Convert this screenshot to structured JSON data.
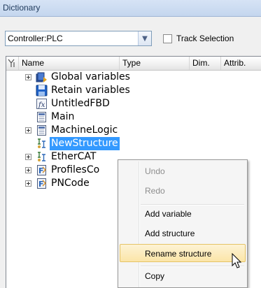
{
  "window": {
    "title": "Dictionary"
  },
  "toolbar": {
    "controller_select": "Controller:PLC",
    "track_selection_label": "Track Selection",
    "track_selection_checked": false
  },
  "tree": {
    "columns": [
      {
        "label": "Name"
      },
      {
        "label": "Type"
      },
      {
        "label": "Dim."
      },
      {
        "label": "Attrib."
      }
    ],
    "rows": [
      {
        "label": "Global variables",
        "icon": "global-variables-icon",
        "expandable": true,
        "selected": false
      },
      {
        "label": "Retain variables",
        "icon": "retain-variables-icon",
        "expandable": false,
        "selected": false
      },
      {
        "label": "UntitledFBD",
        "icon": "fbd-program-icon",
        "expandable": false,
        "selected": false
      },
      {
        "label": "Main",
        "icon": "program-icon",
        "expandable": false,
        "selected": false
      },
      {
        "label": "MachineLogic",
        "icon": "program-icon",
        "expandable": true,
        "selected": false
      },
      {
        "label": "NewStructure",
        "icon": "structure-icon",
        "expandable": false,
        "selected": true
      },
      {
        "label": "EtherCAT",
        "icon": "structure-icon",
        "expandable": true,
        "selected": false
      },
      {
        "label": "ProfilesCo",
        "icon": "function-block-icon",
        "expandable": true,
        "selected": false
      },
      {
        "label": "PNCode",
        "icon": "function-block-icon",
        "expandable": true,
        "selected": false
      }
    ]
  },
  "context_menu": {
    "items": [
      {
        "label": "Undo",
        "enabled": false
      },
      {
        "label": "Redo",
        "enabled": false
      },
      {
        "label": "Add variable",
        "enabled": true
      },
      {
        "label": "Add structure",
        "enabled": true
      },
      {
        "label": "Rename structure",
        "enabled": true,
        "highlighted": true
      },
      {
        "label": "Copy",
        "enabled": true
      }
    ]
  },
  "colors": {
    "selection": "#3399ff",
    "menu_highlight": "#fbe5a8",
    "title_bar": "#c4d6ee"
  }
}
